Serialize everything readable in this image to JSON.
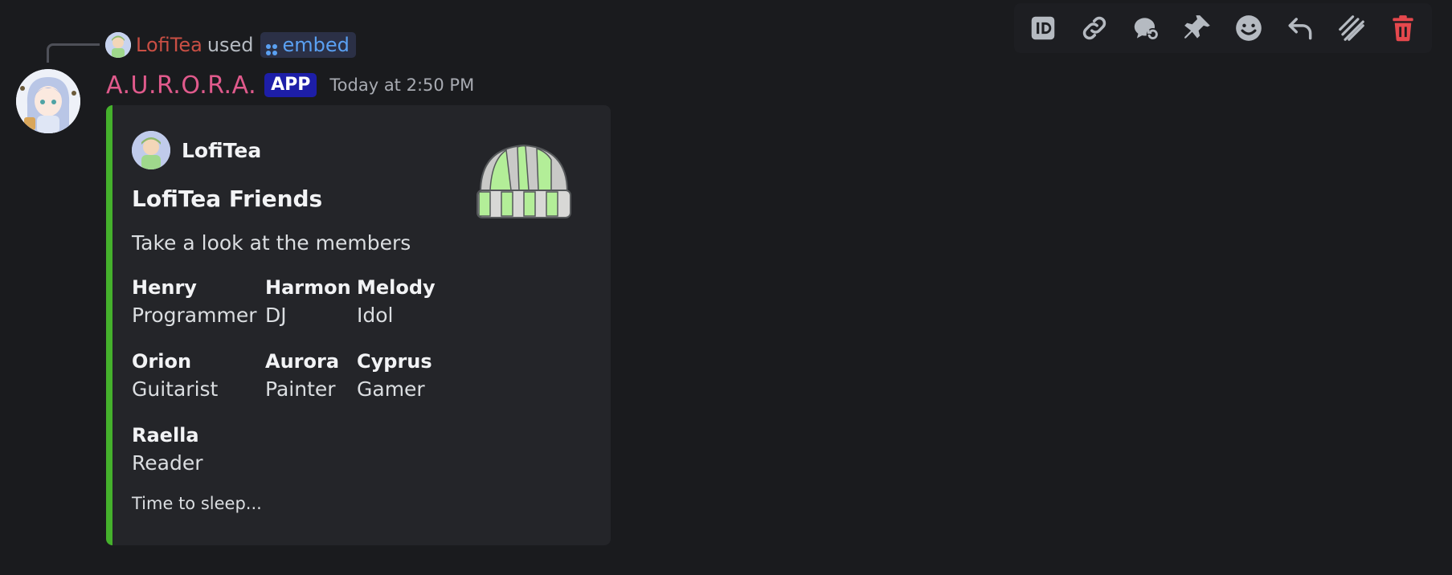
{
  "reply": {
    "username": "LofiTea",
    "used_text": "used",
    "command": "embed"
  },
  "message": {
    "author": "A.U.R.O.R.A.",
    "badge": "APP",
    "timestamp": "Today at 2:50 PM"
  },
  "embed": {
    "accent_color": "#45b12c",
    "author_name": "LofiTea",
    "title": "LofiTea Friends",
    "description": "Take a look at the members",
    "thumbnail": "striped-beanie-hat",
    "fields": [
      {
        "name": "Henry",
        "value": "Programmer"
      },
      {
        "name": "Harmon",
        "value": "DJ"
      },
      {
        "name": "Melody",
        "value": "Idol"
      },
      {
        "name": "Orion",
        "value": "Guitarist"
      },
      {
        "name": "Aurora",
        "value": "Painter"
      },
      {
        "name": "Cyprus",
        "value": "Gamer"
      },
      {
        "name": "Raella",
        "value": "Reader"
      }
    ],
    "footer": "Time to sleep..."
  },
  "toolbar": {
    "icons": [
      "id-icon",
      "link-icon",
      "thread-icon",
      "pin-icon",
      "emoji-icon",
      "reply-icon",
      "tts-icon",
      "trash-icon"
    ],
    "danger_color": "#e5484d"
  }
}
